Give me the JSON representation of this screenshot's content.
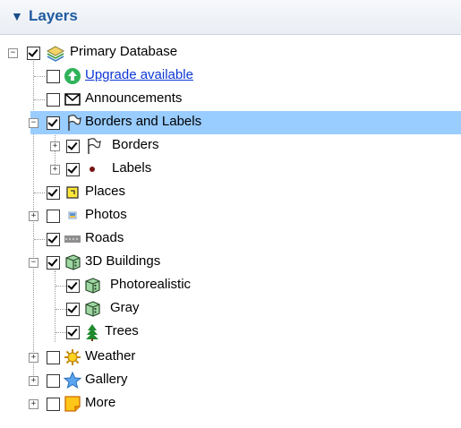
{
  "panel": {
    "title": "Layers",
    "collapse_glyph": "▼"
  },
  "tree": {
    "expander_plus": "+",
    "expander_minus": "−",
    "items": [
      {
        "label": "Primary Database",
        "checked": true,
        "icon": "layers-stack-icon",
        "expander": "minus"
      },
      {
        "label": "Upgrade available",
        "checked": false,
        "icon": "upgrade-arrow-icon",
        "link": true
      },
      {
        "label": "Announcements",
        "checked": false,
        "icon": "envelope-icon"
      },
      {
        "label": "Borders and Labels",
        "checked": true,
        "icon": "flag-icon",
        "expander": "minus",
        "selected": true
      },
      {
        "label": "Borders",
        "checked": true,
        "icon": "flag-icon",
        "expander": "plus"
      },
      {
        "label": "Labels",
        "checked": true,
        "icon": "dot-icon",
        "expander": "plus"
      },
      {
        "label": "Places",
        "checked": true,
        "icon": "places-icon"
      },
      {
        "label": "Photos",
        "checked": false,
        "icon": "photo-icon",
        "expander": "plus"
      },
      {
        "label": "Roads",
        "checked": true,
        "icon": "road-icon"
      },
      {
        "label": "3D Buildings",
        "checked": true,
        "icon": "building-cube-icon",
        "expander": "minus"
      },
      {
        "label": "Photorealistic",
        "checked": true,
        "icon": "building-cube-icon"
      },
      {
        "label": "Gray",
        "checked": true,
        "icon": "building-cube-icon"
      },
      {
        "label": "Trees",
        "checked": true,
        "icon": "tree-icon"
      },
      {
        "label": "Weather",
        "checked": false,
        "icon": "sun-icon",
        "expander": "plus"
      },
      {
        "label": "Gallery",
        "checked": false,
        "icon": "star-icon",
        "expander": "plus"
      },
      {
        "label": "More",
        "checked": false,
        "icon": "note-icon",
        "expander": "plus"
      }
    ]
  },
  "colors": {
    "header_text": "#1f5aa0",
    "selection": "#99ccff",
    "link": "#0b37d6"
  }
}
